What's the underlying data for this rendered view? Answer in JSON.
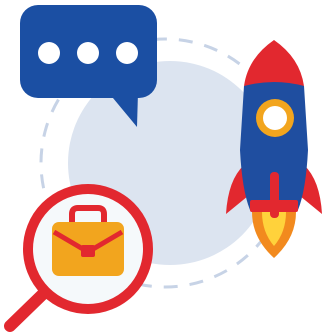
{
  "illustration": {
    "icons": [
      "chat-bubble-icon",
      "rocket-icon",
      "magnifying-glass-icon",
      "briefcase-icon"
    ],
    "colors": {
      "chat_bubble": "#1B4FA3",
      "chat_dots": "#FFFFFF",
      "background_circle": "#DCE4F0",
      "dashed_ring": "#C7D3E6",
      "rocket_body": "#1F4EA0",
      "rocket_nose": "#E2282F",
      "rocket_window_ring": "#F2A51E",
      "rocket_fins": "#E2282F",
      "rocket_flame_outer": "#F28A1E",
      "rocket_flame_inner": "#FFD23B",
      "magnifier_ring": "#E2282F",
      "magnifier_lens": "#F5F9FB",
      "briefcase": "#F2A51E",
      "briefcase_trim": "#E2282F"
    }
  }
}
